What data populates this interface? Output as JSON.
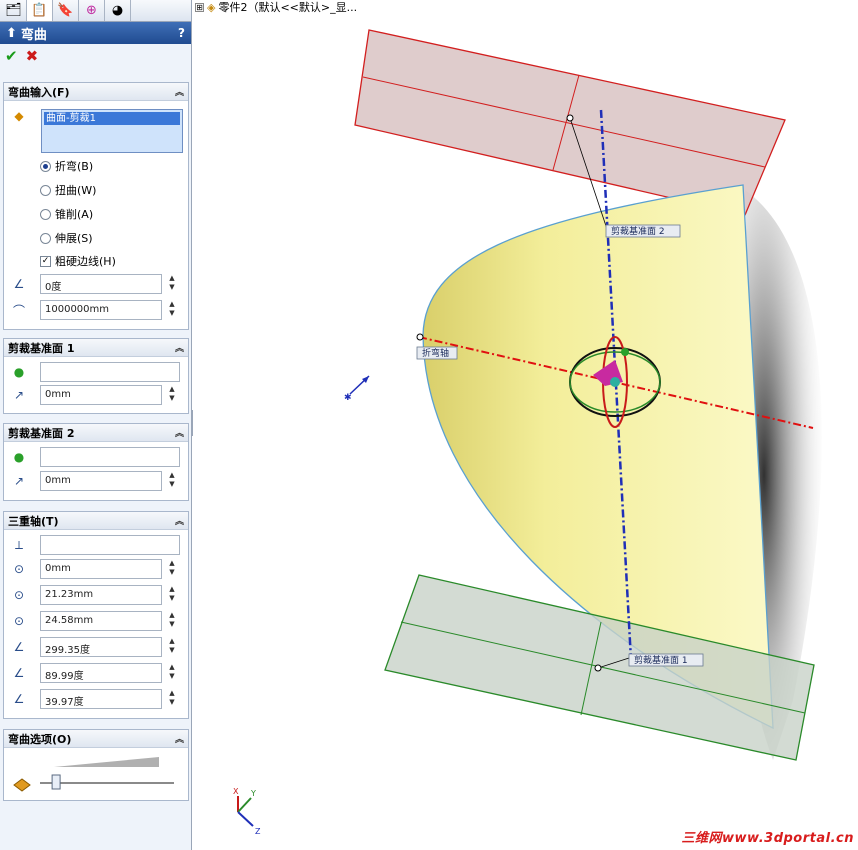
{
  "tree_bar": {
    "expander": "⊞",
    "label": "零件2（默认<<默认>_显..."
  },
  "pm": {
    "tabs": [
      "feature-manager-icon",
      "property-manager-icon",
      "configuration-manager-icon",
      "dimxpert-icon",
      "display-manager-icon"
    ],
    "title": "弯曲",
    "help": "?",
    "ok": "✔",
    "cancel": "✖",
    "groups": {
      "bend_input": {
        "title": "弯曲输入(F)",
        "selection": "曲面-剪裁1",
        "options": [
          {
            "label": "折弯(B)",
            "selected": true
          },
          {
            "label": "扭曲(W)",
            "selected": false
          },
          {
            "label": "锥削(A)",
            "selected": false
          },
          {
            "label": "伸展(S)",
            "selected": false
          }
        ],
        "rigid_label": "粗硬边线(H)",
        "rigid_checked": true,
        "angle": "0度",
        "radius": "1000000mm"
      },
      "trim_plane_1": {
        "title": "剪裁基准面 1",
        "distance": "0mm"
      },
      "trim_plane_2": {
        "title": "剪裁基准面 2",
        "distance": "0mm"
      },
      "triad": {
        "title": "三重轴(T)",
        "x": "0mm",
        "y": "21.23mm",
        "z": "24.58mm",
        "rx": "299.35度",
        "ry": "89.99度",
        "rz": "39.97度"
      },
      "bend_options": {
        "title": "弯曲选项(O)",
        "slider_level": 0.12
      }
    }
  },
  "viewport": {
    "callouts": {
      "trim2": "剪裁基准面 2",
      "trim1": "剪裁基准面 1",
      "bend_axis": "折弯轴"
    },
    "triad_labels": {
      "x": "X",
      "y": "Y",
      "z": "Z"
    },
    "colors": {
      "plane_top": "#d21f1f",
      "plane_bottom": "#2a8a2a",
      "surface": "#f6f2a0",
      "axis_red": "#e01010",
      "axis_blue": "#1f2fb8"
    }
  },
  "watermark": "三维网www.3dportal.cn"
}
